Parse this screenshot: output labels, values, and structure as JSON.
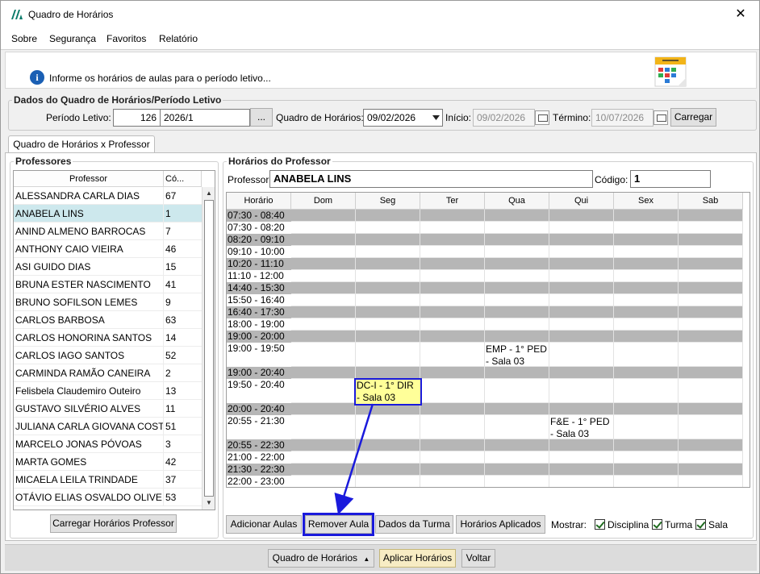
{
  "window": {
    "title": "Quadro de Horários",
    "close_glyph": "✕"
  },
  "menu": [
    "Sobre",
    "Segurança",
    "Favoritos",
    "Relatório"
  ],
  "info": {
    "message": "Informe os horários de aulas para o período letivo..."
  },
  "period": {
    "group_label": "Dados do Quadro de Horários/Período Letivo",
    "periodo_label": "Período Letivo:",
    "periodo_code": "126",
    "periodo_name": "2026/1",
    "browse_label": "...",
    "quadro_label": "Quadro de Horários:",
    "quadro_value": "09/02/2026",
    "inicio_label": "Início:",
    "inicio_value": "09/02/2026",
    "termino_label": "Término:",
    "termino_value": "10/07/2026",
    "load_label": "Carregar"
  },
  "tab": {
    "label": "Quadro de Horários x Professor"
  },
  "professores": {
    "group_label": "Professores",
    "col_name": "Professor",
    "col_code": "Có...",
    "items": [
      {
        "name": "ALESSANDRA CARLA DIAS",
        "code": "67"
      },
      {
        "name": "ANABELA LINS",
        "code": "1"
      },
      {
        "name": "ANIND ALMENO BARROCAS",
        "code": "7"
      },
      {
        "name": "ANTHONY CAIO VIEIRA",
        "code": "46"
      },
      {
        "name": "ASI GUIDO DIAS",
        "code": "15"
      },
      {
        "name": "BRUNA ESTER NASCIMENTO",
        "code": "41"
      },
      {
        "name": "BRUNO SOFILSON LEMES",
        "code": "9"
      },
      {
        "name": "CARLOS BARBOSA",
        "code": "63"
      },
      {
        "name": "CARLOS HONORINA SANTOS",
        "code": "14"
      },
      {
        "name": "CARLOS IAGO SANTOS",
        "code": "52"
      },
      {
        "name": "CARMINDA RAMÃO CANEIRA",
        "code": "2"
      },
      {
        "name": "Felisbela Claudemiro Outeiro",
        "code": "13"
      },
      {
        "name": "GUSTAVO SILVÉRIO ALVES",
        "code": "11"
      },
      {
        "name": "JULIANA CARLA GIOVANA COSTA",
        "code": "51"
      },
      {
        "name": "MARCELO JONAS PÓVOAS",
        "code": "3"
      },
      {
        "name": "MARTA GOMES",
        "code": "42"
      },
      {
        "name": "MICAELA LEILA TRINDADE",
        "code": "37"
      },
      {
        "name": "OTÁVIO ELIAS OSVALDO OLIVEIRA",
        "code": "53"
      }
    ],
    "selected": "ANABELA LINS",
    "load_button": "Carregar Horários Professor"
  },
  "horarios": {
    "group_label": "Horários do Professor",
    "professor_label": "Professor:",
    "professor_value": "ANABELA LINS",
    "codigo_label": "Código:",
    "codigo_value": "1",
    "columns": [
      "Horário",
      "Dom",
      "Seg",
      "Ter",
      "Qua",
      "Qui",
      "Sex",
      "Sab"
    ],
    "rows": [
      {
        "time": "07:30 - 08:40",
        "gray": true
      },
      {
        "time": "07:30 - 08:20",
        "gray": false
      },
      {
        "time": "08:20 - 09:10",
        "gray": true
      },
      {
        "time": "09:10 - 10:00",
        "gray": false
      },
      {
        "time": "10:20 - 11:10",
        "gray": true
      },
      {
        "time": "11:10 - 12:00",
        "gray": false
      },
      {
        "time": "14:40 - 15:30",
        "gray": true
      },
      {
        "time": "15:50 - 16:40",
        "gray": false
      },
      {
        "time": "16:40 - 17:30",
        "gray": true
      },
      {
        "time": "18:00 - 19:00",
        "gray": false
      },
      {
        "time": "19:00 - 20:00",
        "gray": true
      },
      {
        "time": "19:00 - 19:50",
        "gray": false,
        "tall": true
      },
      {
        "time": "19:00 - 20:40",
        "gray": true
      },
      {
        "time": "19:50 - 20:40",
        "gray": false,
        "tall": true
      },
      {
        "time": "20:00 - 20:40",
        "gray": true
      },
      {
        "time": "20:55 - 21:30",
        "gray": false,
        "tall": true
      },
      {
        "time": "20:55 - 22:30",
        "gray": true
      },
      {
        "time": "21:00 - 22:00",
        "gray": false
      },
      {
        "time": "21:30 - 22:30",
        "gray": true
      },
      {
        "time": "22:00 - 23:00",
        "gray": false
      }
    ],
    "entries": [
      {
        "row": 11,
        "day": "Qua",
        "text": "EMP - 1° PED - Sala 03",
        "highlighted": false
      },
      {
        "row": 13,
        "day": "Seg",
        "text": "DC-I - 1° DIR - Sala 03",
        "highlighted": true
      },
      {
        "row": 15,
        "day": "Qui",
        "text": "F&E - 1° PED - Sala 03",
        "highlighted": false
      }
    ]
  },
  "actions": {
    "add": "Adicionar Aulas",
    "remove": "Remover Aula",
    "turma": "Dados da Turma",
    "aplicados": "Horários Aplicados",
    "mostrar_label": "Mostrar:",
    "chk_disciplina": "Disciplina",
    "chk_turma": "Turma",
    "chk_sala": "Sala"
  },
  "footer": {
    "quadro": "Quadro de Horários",
    "aplicar": "Aplicar Horários",
    "voltar": "Voltar"
  },
  "colors": {
    "accent": "#1a1adc",
    "selected_row": "#cde8ed",
    "gray_row": "#b6b6b6",
    "highlight_entry": "#ffff99"
  }
}
